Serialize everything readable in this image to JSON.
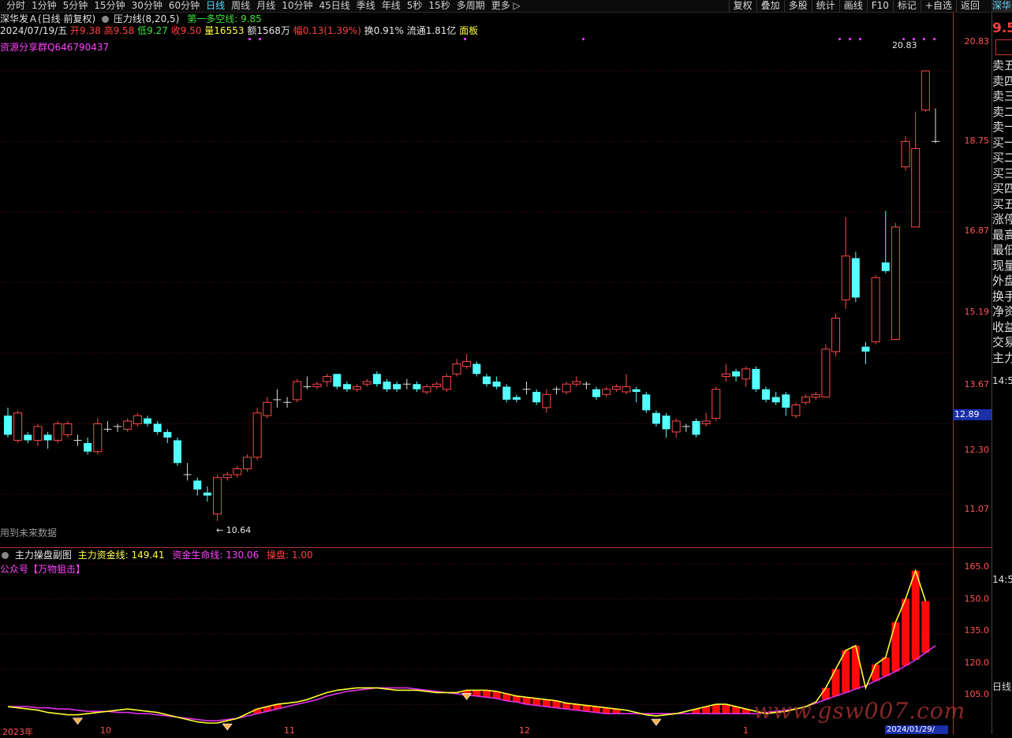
{
  "toolbar": {
    "tabs": [
      "分时",
      "1分钟",
      "5分钟",
      "15分钟",
      "30分钟",
      "60分钟",
      "日线",
      "周线",
      "月线",
      "10分钟",
      "45日线",
      "季线",
      "年线",
      "5秒",
      "15秒",
      "多周期",
      "更多 ▷"
    ],
    "active_tab": "日线",
    "tools": [
      "复权",
      "叠加",
      "多股",
      "统计",
      "画线",
      "F10",
      "标记",
      "+自选",
      "返回"
    ],
    "right_title": "深华"
  },
  "header": {
    "stock": "深华发Ａ(日线 前复权)",
    "indicator": "压力线(8,20,5)",
    "indicator_value": "第一多空线: 9.85",
    "date": "2024/07/19/五",
    "open": "开9.38",
    "high": "高9.58",
    "low": "低9.27",
    "close": "收9.50",
    "vol": "量16553",
    "amount": "额1568万",
    "change": "幅0.13(1.39%)",
    "turnover": "换0.91%",
    "float": "流通1.81亿",
    "board": "面板",
    "promo": "资源分享群Q646790437"
  },
  "main_chart": {
    "annot_high": "20.83",
    "annot_low": "10.64",
    "future_note": "用到未来数据",
    "current_price": "12.89",
    "yticks": [
      "20.83",
      "18.75",
      "16.87",
      "15.19",
      "13.67",
      "12.30",
      "11.07"
    ]
  },
  "sub_chart": {
    "title": "主力操盘副图",
    "line1": "主力资金线: 149.41",
    "line2": "资金生命线: 130.06",
    "line3": "操盘: 1.00",
    "promo": "公众号【万物狙击】",
    "yticks": [
      "165.0",
      "150.0",
      "135.0",
      "120.0",
      "105.0"
    ]
  },
  "xaxis": {
    "labels": [
      "2023年",
      "10",
      "11",
      "12",
      "1"
    ],
    "current_date": "2024/01/29/"
  },
  "right_panel": {
    "price": "9.5",
    "items": [
      "卖五",
      "卖四",
      "卖三",
      "卖二",
      "卖一",
      "买一",
      "买二",
      "买三",
      "买四",
      "买五",
      "涨停",
      "最高",
      "最低",
      "现量",
      "外盘",
      "换手",
      "净资",
      "收益",
      "交易",
      "主力"
    ],
    "time": "14:5",
    "time2": "14:5",
    "bottom": "日线"
  },
  "watermark": "www.gsw007.com",
  "chart_data": {
    "type": "candlestick",
    "ylim": [
      10.4,
      21.2
    ],
    "candles": [
      [
        12.45,
        12.1,
        12.6,
        12.05
      ],
      [
        12.0,
        12.5,
        12.55,
        11.95
      ],
      [
        12.1,
        12.0,
        12.15,
        11.95
      ],
      [
        12.0,
        12.25,
        12.3,
        11.9
      ],
      [
        12.1,
        12.0,
        12.15,
        11.85
      ],
      [
        12.0,
        12.3,
        12.35,
        11.95
      ],
      [
        12.1,
        12.3,
        12.35,
        12.05
      ],
      [
        12.0,
        12.0,
        12.1,
        11.9
      ],
      [
        11.95,
        11.8,
        12.05,
        11.75
      ],
      [
        11.8,
        12.3,
        12.4,
        11.75
      ],
      [
        12.2,
        12.2,
        12.35,
        12.15
      ],
      [
        12.25,
        12.25,
        12.3,
        12.15
      ],
      [
        12.2,
        12.35,
        12.4,
        12.15
      ],
      [
        12.3,
        12.45,
        12.5,
        12.25
      ],
      [
        12.4,
        12.3,
        12.45,
        12.25
      ],
      [
        12.3,
        12.15,
        12.35,
        12.1
      ],
      [
        12.15,
        12.05,
        12.2,
        11.95
      ],
      [
        12.0,
        11.6,
        12.05,
        11.55
      ],
      [
        11.4,
        11.4,
        11.6,
        11.3
      ],
      [
        11.3,
        11.15,
        11.35,
        11.05
      ],
      [
        11.1,
        11.05,
        11.2,
        10.95
      ],
      [
        10.75,
        11.35,
        11.4,
        10.64
      ],
      [
        11.35,
        11.4,
        11.45,
        11.3
      ],
      [
        11.4,
        11.5,
        11.55,
        11.35
      ],
      [
        11.5,
        11.7,
        11.75,
        11.45
      ],
      [
        11.7,
        12.5,
        12.6,
        11.65
      ],
      [
        12.45,
        12.7,
        12.8,
        12.4
      ],
      [
        12.75,
        12.75,
        12.95,
        12.6
      ],
      [
        12.7,
        12.7,
        12.8,
        12.6
      ],
      [
        12.75,
        13.1,
        13.15,
        12.7
      ],
      [
        13.0,
        13.0,
        13.2,
        12.95
      ],
      [
        13.0,
        13.05,
        13.1,
        12.95
      ],
      [
        13.1,
        13.2,
        13.25,
        13.0
      ],
      [
        13.25,
        13.0,
        13.25,
        12.95
      ],
      [
        13.05,
        12.95,
        13.1,
        12.9
      ],
      [
        12.95,
        13.0,
        13.05,
        12.9
      ],
      [
        13.05,
        13.1,
        13.15,
        13.0
      ],
      [
        13.25,
        13.05,
        13.3,
        13.0
      ],
      [
        13.1,
        12.95,
        13.15,
        12.9
      ],
      [
        13.05,
        12.95,
        13.1,
        12.9
      ],
      [
        13.05,
        13.05,
        13.15,
        12.95
      ],
      [
        13.05,
        12.95,
        13.1,
        12.9
      ],
      [
        12.9,
        13.0,
        13.05,
        12.85
      ],
      [
        13.0,
        13.05,
        13.1,
        12.95
      ],
      [
        12.95,
        13.2,
        13.25,
        12.9
      ],
      [
        13.25,
        13.45,
        13.55,
        13.2
      ],
      [
        13.4,
        13.5,
        13.65,
        13.35
      ],
      [
        13.45,
        13.25,
        13.5,
        13.2
      ],
      [
        13.2,
        13.05,
        13.25,
        13.0
      ],
      [
        13.1,
        13.0,
        13.2,
        12.95
      ],
      [
        13.0,
        12.75,
        13.05,
        12.7
      ],
      [
        12.8,
        12.75,
        12.85,
        12.7
      ],
      [
        12.95,
        12.95,
        13.1,
        12.85
      ],
      [
        12.9,
        12.7,
        12.95,
        12.65
      ],
      [
        12.6,
        12.85,
        12.95,
        12.5
      ],
      [
        12.95,
        12.95,
        13.0,
        12.85
      ],
      [
        12.9,
        13.05,
        13.1,
        12.85
      ],
      [
        13.05,
        13.1,
        13.2,
        13.0
      ],
      [
        13.05,
        13.05,
        13.1,
        12.95
      ],
      [
        12.95,
        12.8,
        13.0,
        12.75
      ],
      [
        12.85,
        12.95,
        13.0,
        12.8
      ],
      [
        12.95,
        13.0,
        13.05,
        12.9
      ],
      [
        12.9,
        13.0,
        13.25,
        12.85
      ],
      [
        12.95,
        12.9,
        13.0,
        12.7
      ],
      [
        12.85,
        12.55,
        12.9,
        12.5
      ],
      [
        12.5,
        12.3,
        12.55,
        12.25
      ],
      [
        12.45,
        12.2,
        12.5,
        12.05
      ],
      [
        12.15,
        12.35,
        12.4,
        12.05
      ],
      [
        12.25,
        12.25,
        12.3,
        12.15
      ],
      [
        12.35,
        12.1,
        12.4,
        12.05
      ],
      [
        12.3,
        12.35,
        12.5,
        12.25
      ],
      [
        12.4,
        12.95,
        13.0,
        12.35
      ],
      [
        13.2,
        13.25,
        13.45,
        13.1
      ],
      [
        13.3,
        13.2,
        13.35,
        13.1
      ],
      [
        13.15,
        13.35,
        13.4,
        13.0
      ],
      [
        13.35,
        12.95,
        13.4,
        12.9
      ],
      [
        12.95,
        12.75,
        13.0,
        12.7
      ],
      [
        12.8,
        12.7,
        12.9,
        12.65
      ],
      [
        12.85,
        12.6,
        12.9,
        12.45
      ],
      [
        12.45,
        12.65,
        12.7,
        12.4
      ],
      [
        12.7,
        12.8,
        12.85,
        12.65
      ],
      [
        12.8,
        12.85,
        12.9,
        12.75
      ],
      [
        12.8,
        13.75,
        13.85,
        12.8
      ],
      [
        13.7,
        14.4,
        14.5,
        13.6
      ],
      [
        14.8,
        15.8,
        16.75,
        14.6
      ],
      [
        15.75,
        14.85,
        15.9,
        14.75
      ],
      [
        13.8,
        13.7,
        13.9,
        13.45
      ],
      [
        13.9,
        15.3,
        15.35,
        13.85
      ],
      [
        15.65,
        15.45,
        16.9,
        15.4
      ],
      [
        13.95,
        16.5,
        16.6,
        13.95
      ],
      [
        18.05,
        18.75,
        18.9,
        17.95
      ],
      [
        16.5,
        18.55,
        19.6,
        16.5
      ],
      [
        19.65,
        20.83,
        20.83,
        19.6
      ],
      [
        18.75,
        18.75,
        19.7,
        18.7
      ]
    ],
    "sub_ylim": [
      96,
      170
    ],
    "main_line": [
      104,
      103.5,
      103,
      102.5,
      101.5,
      101,
      100.5,
      100.5,
      101,
      101.5,
      102,
      102.5,
      103,
      102.5,
      102,
      101.5,
      100.5,
      99.5,
      98.5,
      97.5,
      97,
      97,
      98,
      99,
      101,
      103,
      104,
      105,
      105.5,
      106,
      107,
      108.5,
      110,
      111,
      111.5,
      112,
      112,
      112,
      111.5,
      111,
      111,
      111,
      110.5,
      110,
      110,
      110,
      111,
      111,
      111,
      110.5,
      109.5,
      108.5,
      108,
      107.5,
      107,
      106.5,
      105.5,
      105,
      104.5,
      104,
      103.5,
      103,
      102.5,
      101.5,
      100.5,
      100,
      100.5,
      101,
      102,
      103,
      104,
      105,
      105,
      104,
      103,
      102,
      101,
      101.5,
      102,
      103,
      104,
      106,
      112,
      120,
      128,
      130,
      112,
      122,
      125,
      140,
      150,
      162,
      149
    ],
    "life_line": [
      104,
      104,
      104,
      103.5,
      103.5,
      103,
      103,
      102.5,
      102,
      102,
      102,
      101.5,
      101.5,
      101,
      101,
      100.5,
      100,
      99.5,
      99,
      98.5,
      98,
      98,
      98.5,
      99,
      100,
      101,
      102,
      103,
      104,
      105,
      106,
      107,
      108.5,
      109.5,
      110.5,
      111,
      111.5,
      112,
      112,
      112,
      112,
      111.5,
      111,
      110.5,
      110,
      109.5,
      109,
      108.5,
      108,
      107.5,
      106.5,
      106,
      105,
      104.5,
      104,
      103.5,
      103,
      102.5,
      102,
      101.5,
      101,
      101,
      101,
      101,
      101,
      101,
      101,
      101,
      101,
      101,
      101,
      101,
      101,
      101,
      101,
      101,
      101.5,
      102,
      102.5,
      103,
      104,
      105.5,
      107,
      108.5,
      110,
      111.5,
      113,
      115,
      117,
      119,
      121.5,
      124,
      127,
      130
    ]
  }
}
